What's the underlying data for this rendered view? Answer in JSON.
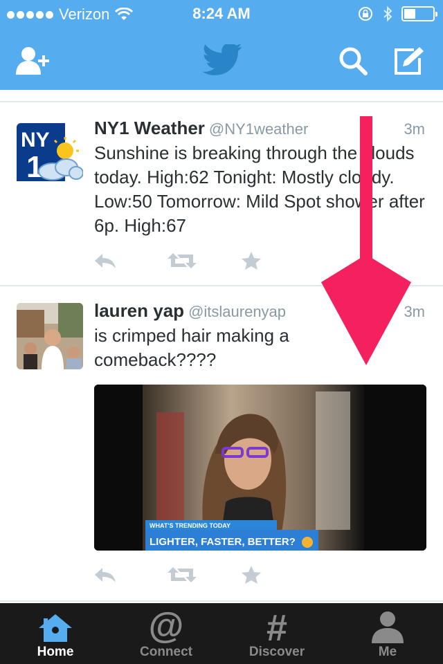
{
  "status_bar": {
    "carrier": "Verizon",
    "time": "8:24 AM",
    "battery_level": 0.4
  },
  "nav": {
    "add_user_icon": "add-user-icon",
    "logo_icon": "twitter-bird-icon",
    "search_icon": "search-icon",
    "compose_icon": "compose-icon"
  },
  "tweets": [
    {
      "name": "NY1 Weather",
      "handle": "@NY1weather",
      "time": "3m",
      "text": "Sunshine is breaking through the clouds today. High:62 Tonight: Mostly cloudy. Low:50 Tomorrow: Mild Spot shower after 6p. High:67",
      "avatar_text": "NY1"
    },
    {
      "name": "lauren yap",
      "handle": "@itslaurenyap",
      "time": "3m",
      "text": "is crimped hair making a comeback????",
      "media": {
        "banner_top": "WHAT'S TRENDING TODAY",
        "banner_main": "LIGHTER, FASTER, BETTER?"
      }
    }
  ],
  "tabs": [
    {
      "label": "Home",
      "icon": "home-icon",
      "active": true
    },
    {
      "label": "Connect",
      "icon": "at-icon",
      "active": false
    },
    {
      "label": "Discover",
      "icon": "hashtag-icon",
      "active": false
    },
    {
      "label": "Me",
      "icon": "person-icon",
      "active": false
    }
  ],
  "colors": {
    "brand": "#55acee",
    "text": "#292f33",
    "muted": "#8899a6",
    "tabbar": "#1a1a1a",
    "overlay_arrow": "#f5215e"
  }
}
